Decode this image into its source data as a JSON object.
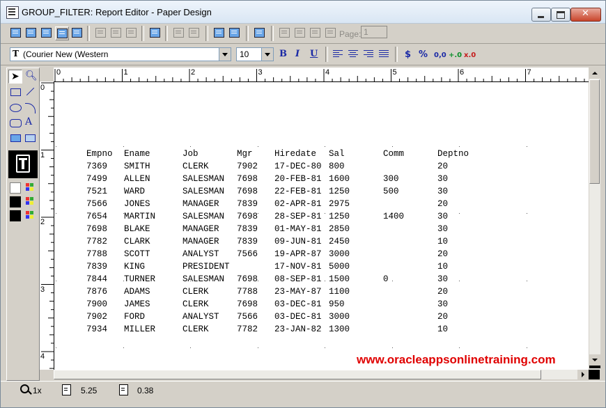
{
  "window": {
    "title": "GROUP_FILTER: Report Editor - Paper Design"
  },
  "toolbar1": {
    "page_label": "Page:",
    "page_value": "1"
  },
  "toolbar2": {
    "font_value": "(Courier New (Western",
    "font_icon": "truetype-icon",
    "size_value": "10",
    "bold": "B",
    "italic": "I",
    "underline": "U",
    "currency": "$",
    "percent": "%",
    "commas": "0,0",
    "add_decimal": "+.0",
    "remove_decimal": "x.0"
  },
  "ruler": {
    "h_labels": [
      "0",
      "1",
      "2",
      "3",
      "4",
      "5",
      "6",
      "7"
    ],
    "v_labels": [
      "0",
      "1",
      "2",
      "3",
      "4"
    ]
  },
  "report": {
    "headers": [
      "Empno",
      "Ename",
      "Job",
      "Mgr",
      "Hiredate",
      "Sal",
      "Comm",
      "Deptno"
    ],
    "rows": [
      [
        "7369",
        "SMITH",
        "CLERK",
        "7902",
        "17-DEC-80",
        "800",
        "",
        "20"
      ],
      [
        "7499",
        "ALLEN",
        "SALESMAN",
        "7698",
        "20-FEB-81",
        "1600",
        "300",
        "30"
      ],
      [
        "7521",
        "WARD",
        "SALESMAN",
        "7698",
        "22-FEB-81",
        "1250",
        "500",
        "30"
      ],
      [
        "7566",
        "JONES",
        "MANAGER",
        "7839",
        "02-APR-81",
        "2975",
        "",
        "20"
      ],
      [
        "7654",
        "MARTIN",
        "SALESMAN",
        "7698",
        "28-SEP-81",
        "1250",
        "1400",
        "30"
      ],
      [
        "7698",
        "BLAKE",
        "MANAGER",
        "7839",
        "01-MAY-81",
        "2850",
        "",
        "30"
      ],
      [
        "7782",
        "CLARK",
        "MANAGER",
        "7839",
        "09-JUN-81",
        "2450",
        "",
        "10"
      ],
      [
        "7788",
        "SCOTT",
        "ANALYST",
        "7566",
        "19-APR-87",
        "3000",
        "",
        "20"
      ],
      [
        "7839",
        "KING",
        "PRESIDENT",
        "",
        "17-NOV-81",
        "5000",
        "",
        "10"
      ],
      [
        "7844",
        "TURNER",
        "SALESMAN",
        "7698",
        "08-SEP-81",
        "1500",
        "0",
        "30"
      ],
      [
        "7876",
        "ADAMS",
        "CLERK",
        "7788",
        "23-MAY-87",
        "1100",
        "",
        "20"
      ],
      [
        "7900",
        "JAMES",
        "CLERK",
        "7698",
        "03-DEC-81",
        "950",
        "",
        "30"
      ],
      [
        "7902",
        "FORD",
        "ANALYST",
        "7566",
        "03-DEC-81",
        "3000",
        "",
        "20"
      ],
      [
        "7934",
        "MILLER",
        "CLERK",
        "7782",
        "23-JAN-82",
        "1300",
        "",
        "10"
      ]
    ]
  },
  "watermark": {
    "text": "www.oracleappsonlinetraining.com",
    "color": "#e00000"
  },
  "statusbar": {
    "zoom": "1x",
    "pos_x": "5.25",
    "pos_y": "0.38"
  }
}
